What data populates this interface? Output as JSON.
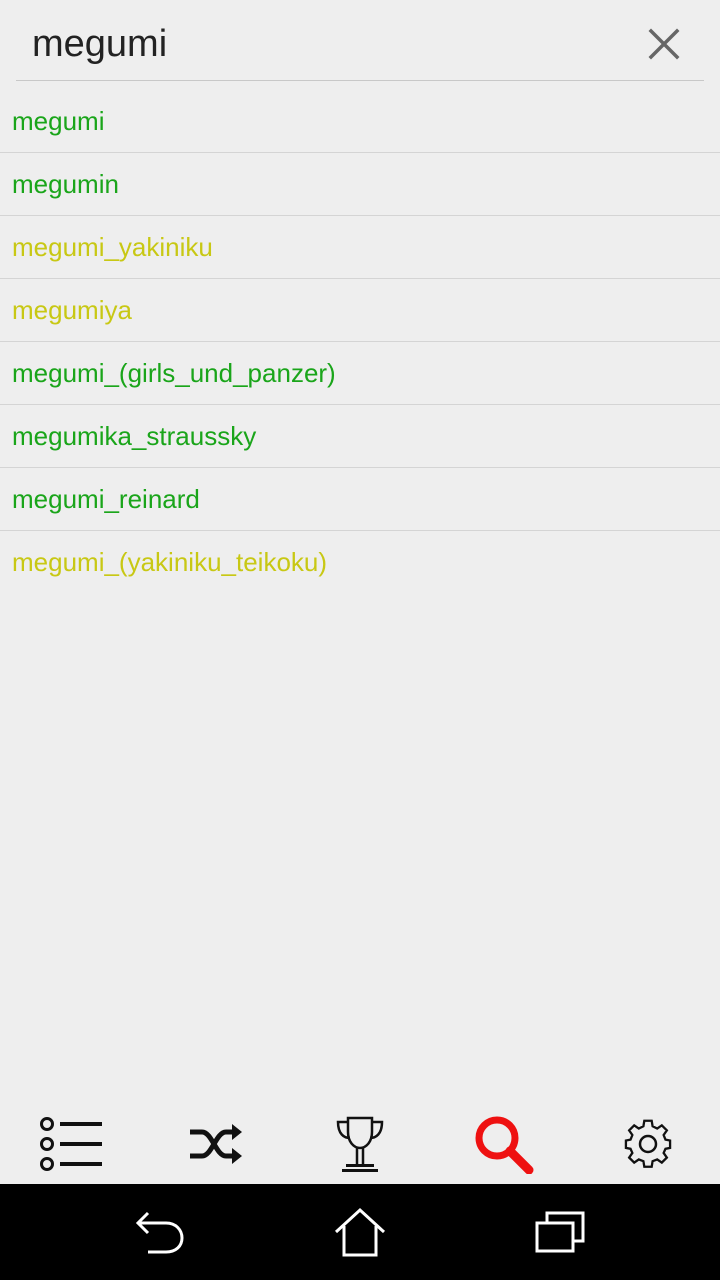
{
  "search": {
    "value": "megumi",
    "clear_icon": "close-icon"
  },
  "suggestions": [
    {
      "text": "megumi",
      "color": "#1aa51a"
    },
    {
      "text": "megumin",
      "color": "#1aa51a"
    },
    {
      "text": "megumi_yakiniku",
      "color": "#c8c814"
    },
    {
      "text": "megumiya",
      "color": "#c8c814"
    },
    {
      "text": "megumi_(girls_und_panzer)",
      "color": "#1aa51a"
    },
    {
      "text": "megumika_straussky",
      "color": "#1aa51a"
    },
    {
      "text": "megumi_reinard",
      "color": "#1aa51a"
    },
    {
      "text": "megumi_(yakiniku_teikoku)",
      "color": "#c8c814"
    }
  ],
  "tabs": [
    {
      "icon": "list-icon",
      "active": false
    },
    {
      "icon": "shuffle-icon",
      "active": false
    },
    {
      "icon": "trophy-icon",
      "active": false
    },
    {
      "icon": "search-icon",
      "active": true
    },
    {
      "icon": "gear-icon",
      "active": false
    }
  ],
  "colors": {
    "background": "#eeeeee",
    "active_tab": "#ee1111",
    "inactive_tab": "#111111",
    "nav_bar": "#000000"
  },
  "system_nav": [
    "back-icon",
    "home-icon",
    "recent-apps-icon"
  ]
}
